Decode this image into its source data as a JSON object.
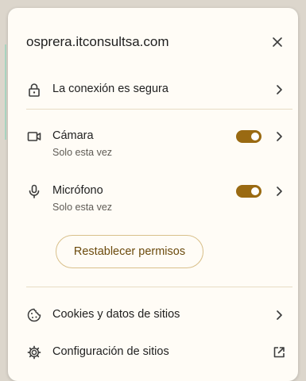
{
  "site": {
    "domain": "osprera.itconsultsa.com"
  },
  "connection": {
    "label": "La conexión es segura",
    "icon": "lock-icon"
  },
  "permissions": [
    {
      "label": "Cámara",
      "sublabel": "Solo esta vez",
      "icon": "camera-icon",
      "enabled": true
    },
    {
      "label": "Micrófono",
      "sublabel": "Solo esta vez",
      "icon": "microphone-icon",
      "enabled": true
    }
  ],
  "reset_button": {
    "label": "Restablecer permisos"
  },
  "cookies": {
    "label": "Cookies y datos de sitios",
    "icon": "cookie-icon"
  },
  "site_settings": {
    "label": "Configuración de sitios",
    "icon": "gear-icon",
    "action_icon": "open-in-new-icon"
  },
  "colors": {
    "toggle_on": "#9a6a12",
    "button_border": "#d9c08b",
    "button_text": "#6b4a0c",
    "divider": "#e7dcc4",
    "popup_bg": "#fffcf6"
  }
}
